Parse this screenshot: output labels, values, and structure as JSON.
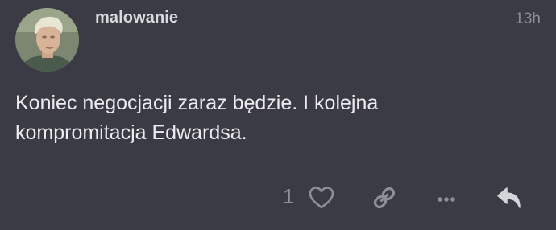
{
  "post": {
    "username": "malowanie",
    "timestamp": "13h",
    "text": "Koniec negocjacji zaraz będzie. I kolejna kompromitacja Edwardsa."
  },
  "actions": {
    "like_count": "1",
    "like_icon": "heart-icon",
    "link_icon": "link-icon",
    "more_icon": "ellipsis-icon",
    "reply_icon": "reply-icon"
  },
  "colors": {
    "background": "#3a3b44",
    "username": "#d8d9dd",
    "text": "#ececef",
    "muted": "#8e8f96",
    "reply_icon": "#d4d5da"
  }
}
